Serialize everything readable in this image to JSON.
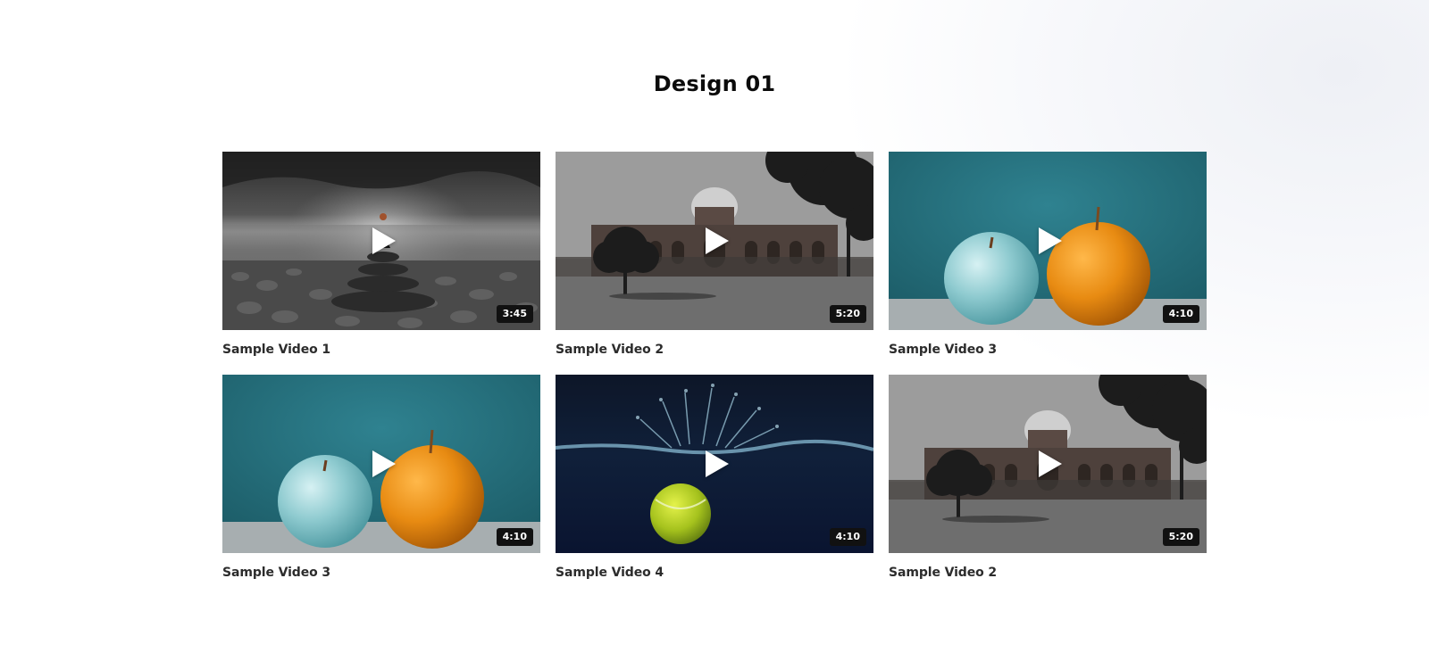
{
  "page": {
    "title": "Design 01"
  },
  "videos": [
    {
      "title": "Sample Video 1",
      "duration": "3:45",
      "scene": "stones-sea"
    },
    {
      "title": "Sample Video 2",
      "duration": "5:20",
      "scene": "monument"
    },
    {
      "title": "Sample Video 3",
      "duration": "4:10",
      "scene": "fruits"
    },
    {
      "title": "Sample Video 3",
      "duration": "4:10",
      "scene": "fruits"
    },
    {
      "title": "Sample Video 4",
      "duration": "4:10",
      "scene": "tennis-ball-splash"
    },
    {
      "title": "Sample Video 2",
      "duration": "5:20",
      "scene": "monument"
    }
  ],
  "icons": {
    "play": "play-icon"
  },
  "colors": {
    "badge_bg": "#111111",
    "title_text": "#0b0b0b",
    "card_text": "#2c2c2c"
  }
}
